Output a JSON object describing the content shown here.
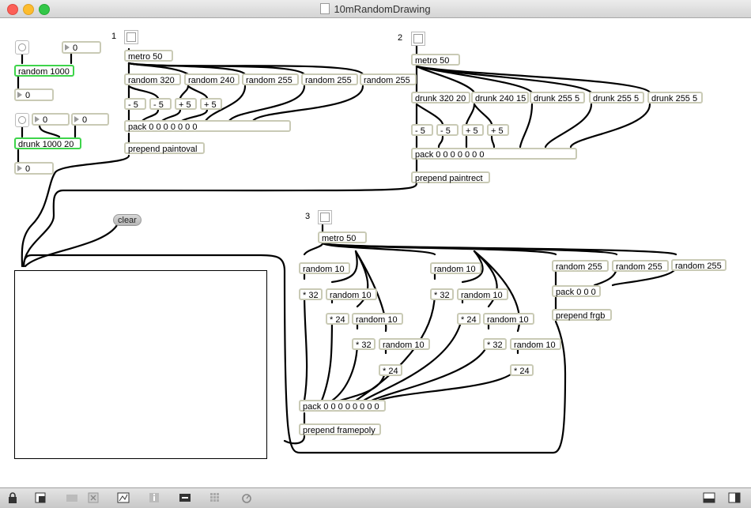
{
  "window": {
    "title": "10mRandomDrawing"
  },
  "section_labels": {
    "one": "1",
    "two": "2",
    "three": "3"
  },
  "left": {
    "random1000": "random 1000",
    "random1000_out": "0",
    "random1000_in": "0",
    "drunk": "drunk 1000 20",
    "drunk_in1": "0",
    "drunk_in2": "0",
    "drunk_out": "0"
  },
  "clear_label": "clear",
  "sec1": {
    "metro": "metro 50",
    "randoms": [
      "random 320",
      "random 240",
      "random 255",
      "random 255",
      "random 255"
    ],
    "ops": [
      "- 5",
      "- 5",
      "+ 5",
      "+ 5"
    ],
    "pack": "pack 0 0 0 0 0 0 0",
    "prepend": "prepend paintoval"
  },
  "sec2": {
    "metro": "metro 50",
    "drunks": [
      "drunk 320 20",
      "drunk 240 15",
      "drunk 255 5",
      "drunk 255 5",
      "drunk 255 5"
    ],
    "ops": [
      "- 5",
      "- 5",
      "+ 5",
      "+ 5"
    ],
    "pack": "pack 0 0 0 0 0 0 0",
    "prepend": "prepend paintrect"
  },
  "sec3": {
    "metro": "metro 50",
    "r10": "random 10",
    "m32": "* 32",
    "m24": "* 24",
    "r255": "random 255",
    "pack_color": "pack 0 0 0",
    "prepend_color": "prepend frgb",
    "pack_poly": "pack 0 0 0 0 0 0 0 0",
    "prepend_poly": "prepend framepoly"
  },
  "toolbar_icons": [
    "lock-icon",
    "presentation-icon",
    "paint-icon",
    "clear-icon",
    "lcd-icon",
    "info-icon",
    "patch-cord-icon",
    "grid-icon",
    "snap-icon",
    "split-left-icon",
    "split-right-icon"
  ]
}
